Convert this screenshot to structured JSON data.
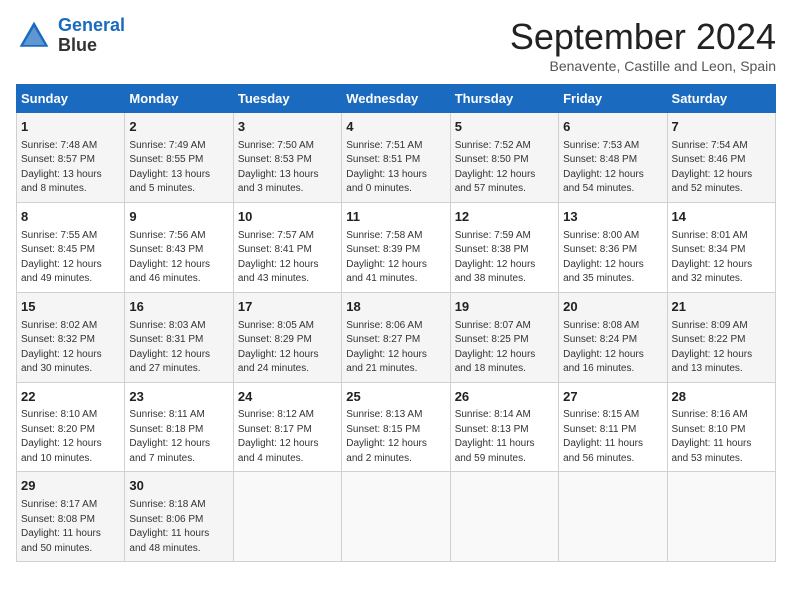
{
  "header": {
    "logo_line1": "General",
    "logo_line2": "Blue",
    "month": "September 2024",
    "location": "Benavente, Castille and Leon, Spain"
  },
  "weekdays": [
    "Sunday",
    "Monday",
    "Tuesday",
    "Wednesday",
    "Thursday",
    "Friday",
    "Saturday"
  ],
  "weeks": [
    [
      {
        "day": "1",
        "info": "Sunrise: 7:48 AM\nSunset: 8:57 PM\nDaylight: 13 hours\nand 8 minutes."
      },
      {
        "day": "2",
        "info": "Sunrise: 7:49 AM\nSunset: 8:55 PM\nDaylight: 13 hours\nand 5 minutes."
      },
      {
        "day": "3",
        "info": "Sunrise: 7:50 AM\nSunset: 8:53 PM\nDaylight: 13 hours\nand 3 minutes."
      },
      {
        "day": "4",
        "info": "Sunrise: 7:51 AM\nSunset: 8:51 PM\nDaylight: 13 hours\nand 0 minutes."
      },
      {
        "day": "5",
        "info": "Sunrise: 7:52 AM\nSunset: 8:50 PM\nDaylight: 12 hours\nand 57 minutes."
      },
      {
        "day": "6",
        "info": "Sunrise: 7:53 AM\nSunset: 8:48 PM\nDaylight: 12 hours\nand 54 minutes."
      },
      {
        "day": "7",
        "info": "Sunrise: 7:54 AM\nSunset: 8:46 PM\nDaylight: 12 hours\nand 52 minutes."
      }
    ],
    [
      {
        "day": "8",
        "info": "Sunrise: 7:55 AM\nSunset: 8:45 PM\nDaylight: 12 hours\nand 49 minutes."
      },
      {
        "day": "9",
        "info": "Sunrise: 7:56 AM\nSunset: 8:43 PM\nDaylight: 12 hours\nand 46 minutes."
      },
      {
        "day": "10",
        "info": "Sunrise: 7:57 AM\nSunset: 8:41 PM\nDaylight: 12 hours\nand 43 minutes."
      },
      {
        "day": "11",
        "info": "Sunrise: 7:58 AM\nSunset: 8:39 PM\nDaylight: 12 hours\nand 41 minutes."
      },
      {
        "day": "12",
        "info": "Sunrise: 7:59 AM\nSunset: 8:38 PM\nDaylight: 12 hours\nand 38 minutes."
      },
      {
        "day": "13",
        "info": "Sunrise: 8:00 AM\nSunset: 8:36 PM\nDaylight: 12 hours\nand 35 minutes."
      },
      {
        "day": "14",
        "info": "Sunrise: 8:01 AM\nSunset: 8:34 PM\nDaylight: 12 hours\nand 32 minutes."
      }
    ],
    [
      {
        "day": "15",
        "info": "Sunrise: 8:02 AM\nSunset: 8:32 PM\nDaylight: 12 hours\nand 30 minutes."
      },
      {
        "day": "16",
        "info": "Sunrise: 8:03 AM\nSunset: 8:31 PM\nDaylight: 12 hours\nand 27 minutes."
      },
      {
        "day": "17",
        "info": "Sunrise: 8:05 AM\nSunset: 8:29 PM\nDaylight: 12 hours\nand 24 minutes."
      },
      {
        "day": "18",
        "info": "Sunrise: 8:06 AM\nSunset: 8:27 PM\nDaylight: 12 hours\nand 21 minutes."
      },
      {
        "day": "19",
        "info": "Sunrise: 8:07 AM\nSunset: 8:25 PM\nDaylight: 12 hours\nand 18 minutes."
      },
      {
        "day": "20",
        "info": "Sunrise: 8:08 AM\nSunset: 8:24 PM\nDaylight: 12 hours\nand 16 minutes."
      },
      {
        "day": "21",
        "info": "Sunrise: 8:09 AM\nSunset: 8:22 PM\nDaylight: 12 hours\nand 13 minutes."
      }
    ],
    [
      {
        "day": "22",
        "info": "Sunrise: 8:10 AM\nSunset: 8:20 PM\nDaylight: 12 hours\nand 10 minutes."
      },
      {
        "day": "23",
        "info": "Sunrise: 8:11 AM\nSunset: 8:18 PM\nDaylight: 12 hours\nand 7 minutes."
      },
      {
        "day": "24",
        "info": "Sunrise: 8:12 AM\nSunset: 8:17 PM\nDaylight: 12 hours\nand 4 minutes."
      },
      {
        "day": "25",
        "info": "Sunrise: 8:13 AM\nSunset: 8:15 PM\nDaylight: 12 hours\nand 2 minutes."
      },
      {
        "day": "26",
        "info": "Sunrise: 8:14 AM\nSunset: 8:13 PM\nDaylight: 11 hours\nand 59 minutes."
      },
      {
        "day": "27",
        "info": "Sunrise: 8:15 AM\nSunset: 8:11 PM\nDaylight: 11 hours\nand 56 minutes."
      },
      {
        "day": "28",
        "info": "Sunrise: 8:16 AM\nSunset: 8:10 PM\nDaylight: 11 hours\nand 53 minutes."
      }
    ],
    [
      {
        "day": "29",
        "info": "Sunrise: 8:17 AM\nSunset: 8:08 PM\nDaylight: 11 hours\nand 50 minutes."
      },
      {
        "day": "30",
        "info": "Sunrise: 8:18 AM\nSunset: 8:06 PM\nDaylight: 11 hours\nand 48 minutes."
      },
      {
        "day": "",
        "info": ""
      },
      {
        "day": "",
        "info": ""
      },
      {
        "day": "",
        "info": ""
      },
      {
        "day": "",
        "info": ""
      },
      {
        "day": "",
        "info": ""
      }
    ]
  ]
}
